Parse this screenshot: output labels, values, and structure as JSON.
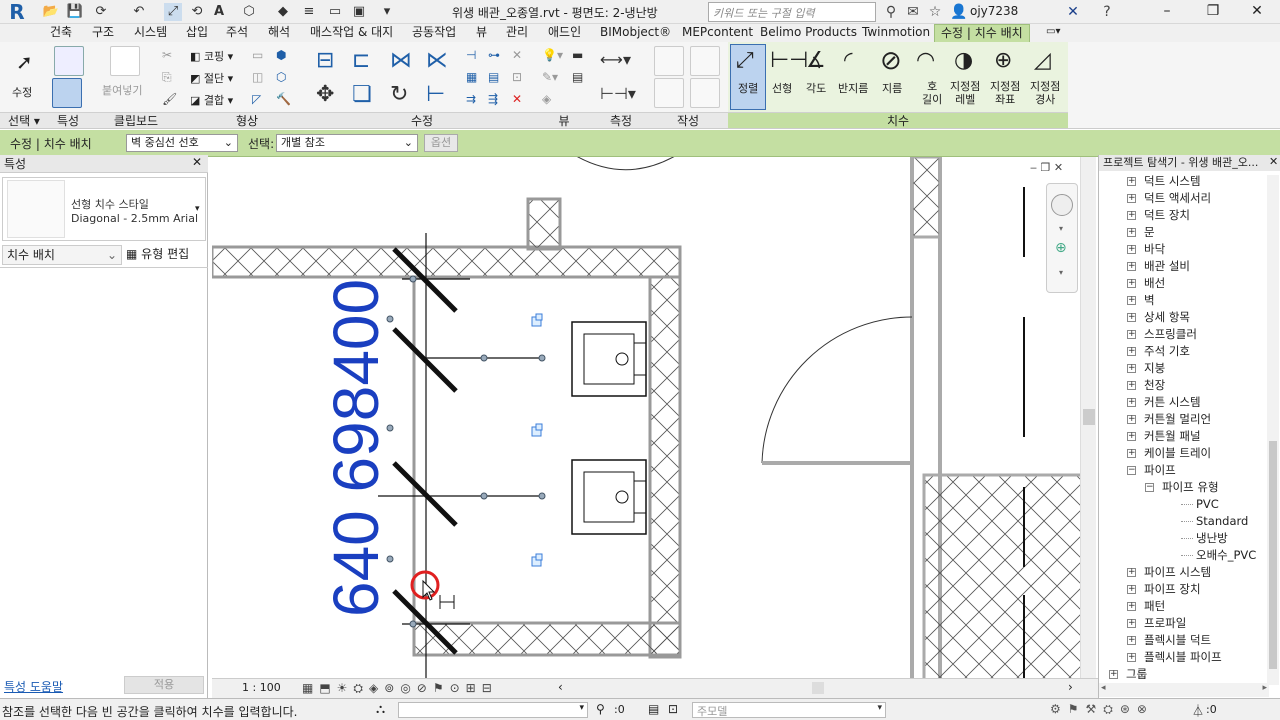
{
  "app": {
    "logo": "R",
    "title": "위생 배관_오종열.rvt - 평면도: 2-냉난방",
    "search_placeholder": "키워드 또는 구절 입력",
    "user": "ojy7238"
  },
  "tabs": [
    "건축",
    "구조",
    "시스템",
    "삽입",
    "주석",
    "해석",
    "매스작업 & 대지",
    "공동작업",
    "뷰",
    "관리",
    "애드인",
    "BIMobject®",
    "MEPcontent",
    "Belimo Products",
    "Twinmotion",
    "수정 | 치수 배치"
  ],
  "ribbon": {
    "select": {
      "modify_label": "수정",
      "panel": "선택 ▾"
    },
    "properties": {
      "panel": "특성"
    },
    "clipboard": {
      "paste_label": "붙여넣기",
      "panel": "클립보드"
    },
    "geometry": {
      "cope": "코핑",
      "cut": "절단",
      "join": "결합",
      "panel": "형상"
    },
    "modify": {
      "panel": "수정"
    },
    "view": {
      "panel": "뷰"
    },
    "measure": {
      "panel": "측정"
    },
    "create": {
      "panel": "작성"
    },
    "dimension": {
      "panel": "치수",
      "items": [
        "정렬",
        "선형",
        "각도",
        "반지름",
        "지름",
        "호\n길이",
        "지정점\n레벨",
        "지정점\n좌표",
        "지정점\n경사"
      ]
    }
  },
  "optbar": {
    "context": "수정 | 치수 배치",
    "ref_select": "벽 중심선 선호",
    "pick_label": "선택:",
    "pick_value": "개별 참조",
    "options_btn": "옵션"
  },
  "properties": {
    "title": "특성",
    "type_name": "선형 치수 스타일",
    "type_value": "Diagonal - 2.5mm Arial",
    "filter": "치수 배치",
    "edit_type": "유형 편집",
    "help": "특성 도움말",
    "apply": "적용"
  },
  "canvas": {
    "dimension_text": "640 698400"
  },
  "viewctl": {
    "scale": "1 : 100"
  },
  "browser": {
    "title": "프로젝트 탐색기 - 위생 배관_오...",
    "items": [
      {
        "label": "덕트 시스템",
        "level": 1,
        "toggle": "+"
      },
      {
        "label": "덕트 액세서리",
        "level": 1,
        "toggle": "+"
      },
      {
        "label": "덕트 장치",
        "level": 1,
        "toggle": "+"
      },
      {
        "label": "문",
        "level": 1,
        "toggle": "+"
      },
      {
        "label": "바닥",
        "level": 1,
        "toggle": "+"
      },
      {
        "label": "배관 설비",
        "level": 1,
        "toggle": "+"
      },
      {
        "label": "배선",
        "level": 1,
        "toggle": "+"
      },
      {
        "label": "벽",
        "level": 1,
        "toggle": "+"
      },
      {
        "label": "상세 항목",
        "level": 1,
        "toggle": "+"
      },
      {
        "label": "스프링클러",
        "level": 1,
        "toggle": "+"
      },
      {
        "label": "주석 기호",
        "level": 1,
        "toggle": "+"
      },
      {
        "label": "지붕",
        "level": 1,
        "toggle": "+"
      },
      {
        "label": "천장",
        "level": 1,
        "toggle": "+"
      },
      {
        "label": "커튼 시스템",
        "level": 1,
        "toggle": "+"
      },
      {
        "label": "커튼월 멀리언",
        "level": 1,
        "toggle": "+"
      },
      {
        "label": "커튼월 패널",
        "level": 1,
        "toggle": "+"
      },
      {
        "label": "케이블 트레이",
        "level": 1,
        "toggle": "+"
      },
      {
        "label": "파이프",
        "level": 1,
        "toggle": "-"
      },
      {
        "label": "파이프 유형",
        "level": 2,
        "toggle": "-"
      },
      {
        "label": "PVC",
        "level": 3,
        "toggle": ""
      },
      {
        "label": "Standard",
        "level": 3,
        "toggle": ""
      },
      {
        "label": "냉난방",
        "level": 3,
        "toggle": ""
      },
      {
        "label": "오배수_PVC",
        "level": 3,
        "toggle": ""
      },
      {
        "label": "파이프 시스템",
        "level": 1,
        "toggle": "+"
      },
      {
        "label": "파이프 장치",
        "level": 1,
        "toggle": "+"
      },
      {
        "label": "패턴",
        "level": 1,
        "toggle": "+"
      },
      {
        "label": "프로파일",
        "level": 1,
        "toggle": "+"
      },
      {
        "label": "플렉시블 덕트",
        "level": 1,
        "toggle": "+"
      },
      {
        "label": "플렉시블 파이프",
        "level": 1,
        "toggle": "+"
      },
      {
        "label": "그룹",
        "level": 0,
        "toggle": "+"
      }
    ]
  },
  "status": {
    "message": "참조를 선택한 다음 빈 공간을 클릭하여 치수를 입력합니다.",
    "count": ":0",
    "model": "주모델",
    "filter_count": ":0"
  }
}
